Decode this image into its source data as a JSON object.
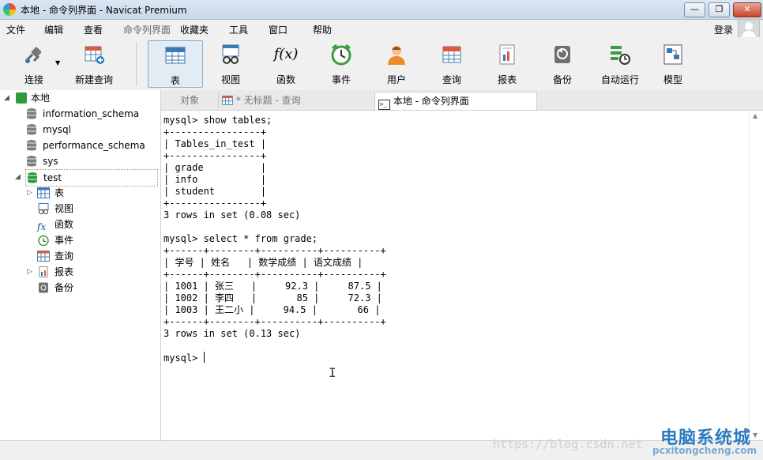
{
  "window": {
    "title": "本地 - 命令列界面 - Navicat Premium",
    "controls": [
      "—",
      "❐",
      "✕"
    ]
  },
  "menu": {
    "items": [
      "文件",
      "编辑",
      "查看",
      "命令列界面",
      "收藏夹",
      "工具",
      "窗口",
      "帮助"
    ],
    "login": "登录"
  },
  "toolbar": {
    "connect": "连接",
    "new_query": "新建查询",
    "table": "表",
    "view": "视图",
    "function": "函数",
    "function_glyph": "f(x)",
    "event": "事件",
    "user": "用户",
    "query": "查询",
    "report": "报表",
    "backup": "备份",
    "automation": "自动运行",
    "model": "模型"
  },
  "sidebar": {
    "connection": "本地",
    "databases": [
      "information_schema",
      "mysql",
      "performance_schema",
      "sys",
      "test"
    ],
    "objects": [
      "表",
      "视图",
      "函数",
      "事件",
      "查询",
      "报表",
      "备份"
    ],
    "function_glyph": "fx"
  },
  "tabs": {
    "objects": "对象",
    "untitled_query": "* 无标题 - 查询",
    "console": "本地 - 命令列界面"
  },
  "console": {
    "lines": [
      "mysql> show tables;",
      "+----------------+",
      "| Tables_in_test |",
      "+----------------+",
      "| grade          |",
      "| info           |",
      "| student        |",
      "+----------------+",
      "3 rows in set (0.08 sec)",
      "",
      "mysql> select * from grade;",
      "+------+--------+----------+----------+",
      "| 学号 | 姓名   | 数学成绩 | 语文成绩 |",
      "+------+--------+----------+----------+",
      "| 1001 | 张三   |     92.3 |     87.5 |",
      "| 1002 | 李四   |       85 |     72.3 |",
      "| 1003 | 王二小 |     94.5 |       66 |",
      "+------+--------+----------+----------+",
      "3 rows in set (0.13 sec)",
      "",
      "mysql> "
    ]
  },
  "watermark": {
    "url": "https://blog.csdn.net",
    "brand": "电脑系统城",
    "brand_sub": "pcxitongcheng.com"
  },
  "colors": {
    "accent": "#2b7bc0",
    "db_active": "#2a9d3c"
  }
}
